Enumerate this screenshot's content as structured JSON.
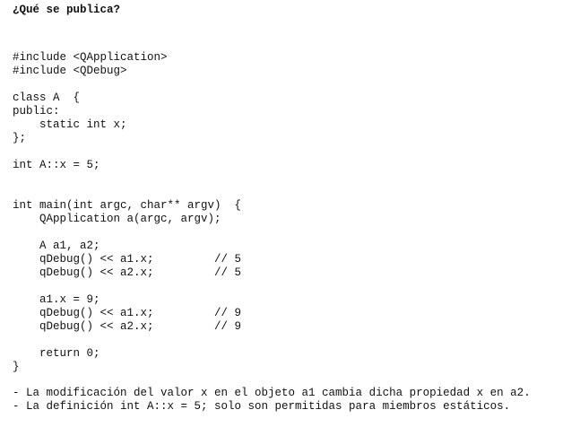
{
  "title": "¿Qué se publica?",
  "code_lines": [
    "#include <QApplication>",
    "#include <QDebug>",
    "",
    "class A  {",
    "public:",
    "    static int x;",
    "};",
    "",
    "int A::x = 5;",
    "",
    "",
    "int main(int argc, char** argv)  {",
    "    QApplication a(argc, argv);",
    "",
    "    A a1, a2;",
    "    qDebug() << a1.x;         // 5",
    "    qDebug() << a2.x;         // 5",
    "",
    "    a1.x = 9;",
    "    qDebug() << a1.x;         // 9",
    "    qDebug() << a2.x;         // 9",
    "",
    "    return 0;",
    "}"
  ],
  "notes": [
    "- La modificación del valor x en el objeto a1 cambia dicha propiedad x en a2.",
    "- La definición int A::x = 5; solo son permitidas para miembros estáticos."
  ]
}
